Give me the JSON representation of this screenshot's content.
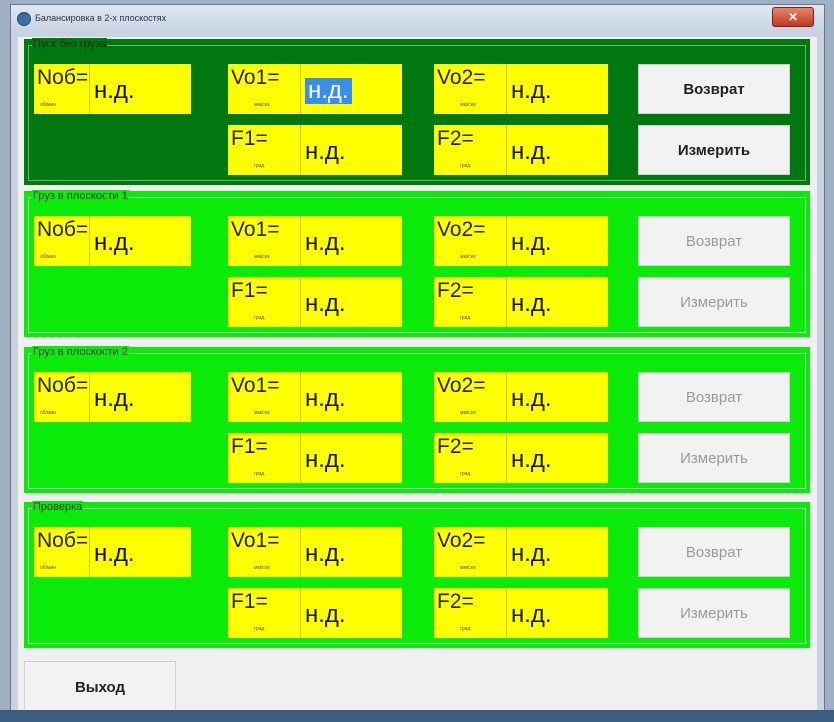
{
  "window": {
    "title": "Балансировка в 2-х плоскостях",
    "close_label": "✕"
  },
  "panels": [
    {
      "title": "Пуск без груза",
      "theme": "dark",
      "n_label": "Nоб=",
      "n_unit": "об/мин",
      "n_value": "н.д.",
      "vo1_label": "Vo1=",
      "vo1_unit": "мм/сек",
      "vo1_value": "н.д.",
      "vo2_label": "Vo2=",
      "vo2_unit": "мм/сек",
      "vo2_value": "н.д.",
      "f1_label": "F1=",
      "f1_unit": "град",
      "f1_value": "н.д.",
      "f2_label": "F2=",
      "f2_unit": "град",
      "f2_value": "н.д.",
      "btn1_label": "Возврат",
      "btn2_label": "Измерить",
      "buttons_enabled": true
    },
    {
      "title": "Груз в плоскости 1",
      "theme": "light",
      "n_label": "Nоб=",
      "n_unit": "об/мин",
      "n_value": "н.д.",
      "vo1_label": "Vo1=",
      "vo1_unit": "мм/сек",
      "vo1_value": "н.д.",
      "vo2_label": "Vo2=",
      "vo2_unit": "мм/сек",
      "vo2_value": "н.д.",
      "f1_label": "F1=",
      "f1_unit": "град",
      "f1_value": "н.д.",
      "f2_label": "F2=",
      "f2_unit": "град",
      "f2_value": "н.д.",
      "btn1_label": "Возврат",
      "btn2_label": "Измерить",
      "buttons_enabled": false
    },
    {
      "title": "Груз в плоскости 2",
      "theme": "light",
      "n_label": "Nоб=",
      "n_unit": "об/мин",
      "n_value": "н.д.",
      "vo1_label": "Vo1=",
      "vo1_unit": "мм/сек",
      "vo1_value": "н.д.",
      "vo2_label": "Vo2=",
      "vo2_unit": "мм/сек",
      "vo2_value": "н.д.",
      "f1_label": "F1=",
      "f1_unit": "град",
      "f1_value": "н.д.",
      "f2_label": "F2=",
      "f2_unit": "град",
      "f2_value": "н.д.",
      "btn1_label": "Возврат",
      "btn2_label": "Измерить",
      "buttons_enabled": false
    },
    {
      "title": "Проверка",
      "theme": "light",
      "n_label": "Nоб=",
      "n_unit": "об/мин",
      "n_value": "н.д.",
      "vo1_label": "Vo1=",
      "vo1_unit": "мм/сек",
      "vo1_value": "н.д.",
      "vo2_label": "Vo2=",
      "vo2_unit": "мм/сек",
      "vo2_value": "н.д.",
      "f1_label": "F1=",
      "f1_unit": "град",
      "f1_value": "н.д.",
      "f2_label": "F2=",
      "f2_unit": "град",
      "f2_value": "н.д.",
      "btn1_label": "Возврат",
      "btn2_label": "Измерить",
      "buttons_enabled": false
    }
  ],
  "exit_label": "Выход",
  "colors": {
    "dark_panel": "#00780f",
    "light_panel": "#0aeb0a",
    "field": "#ffff00",
    "selection": "#3a8ee6"
  }
}
